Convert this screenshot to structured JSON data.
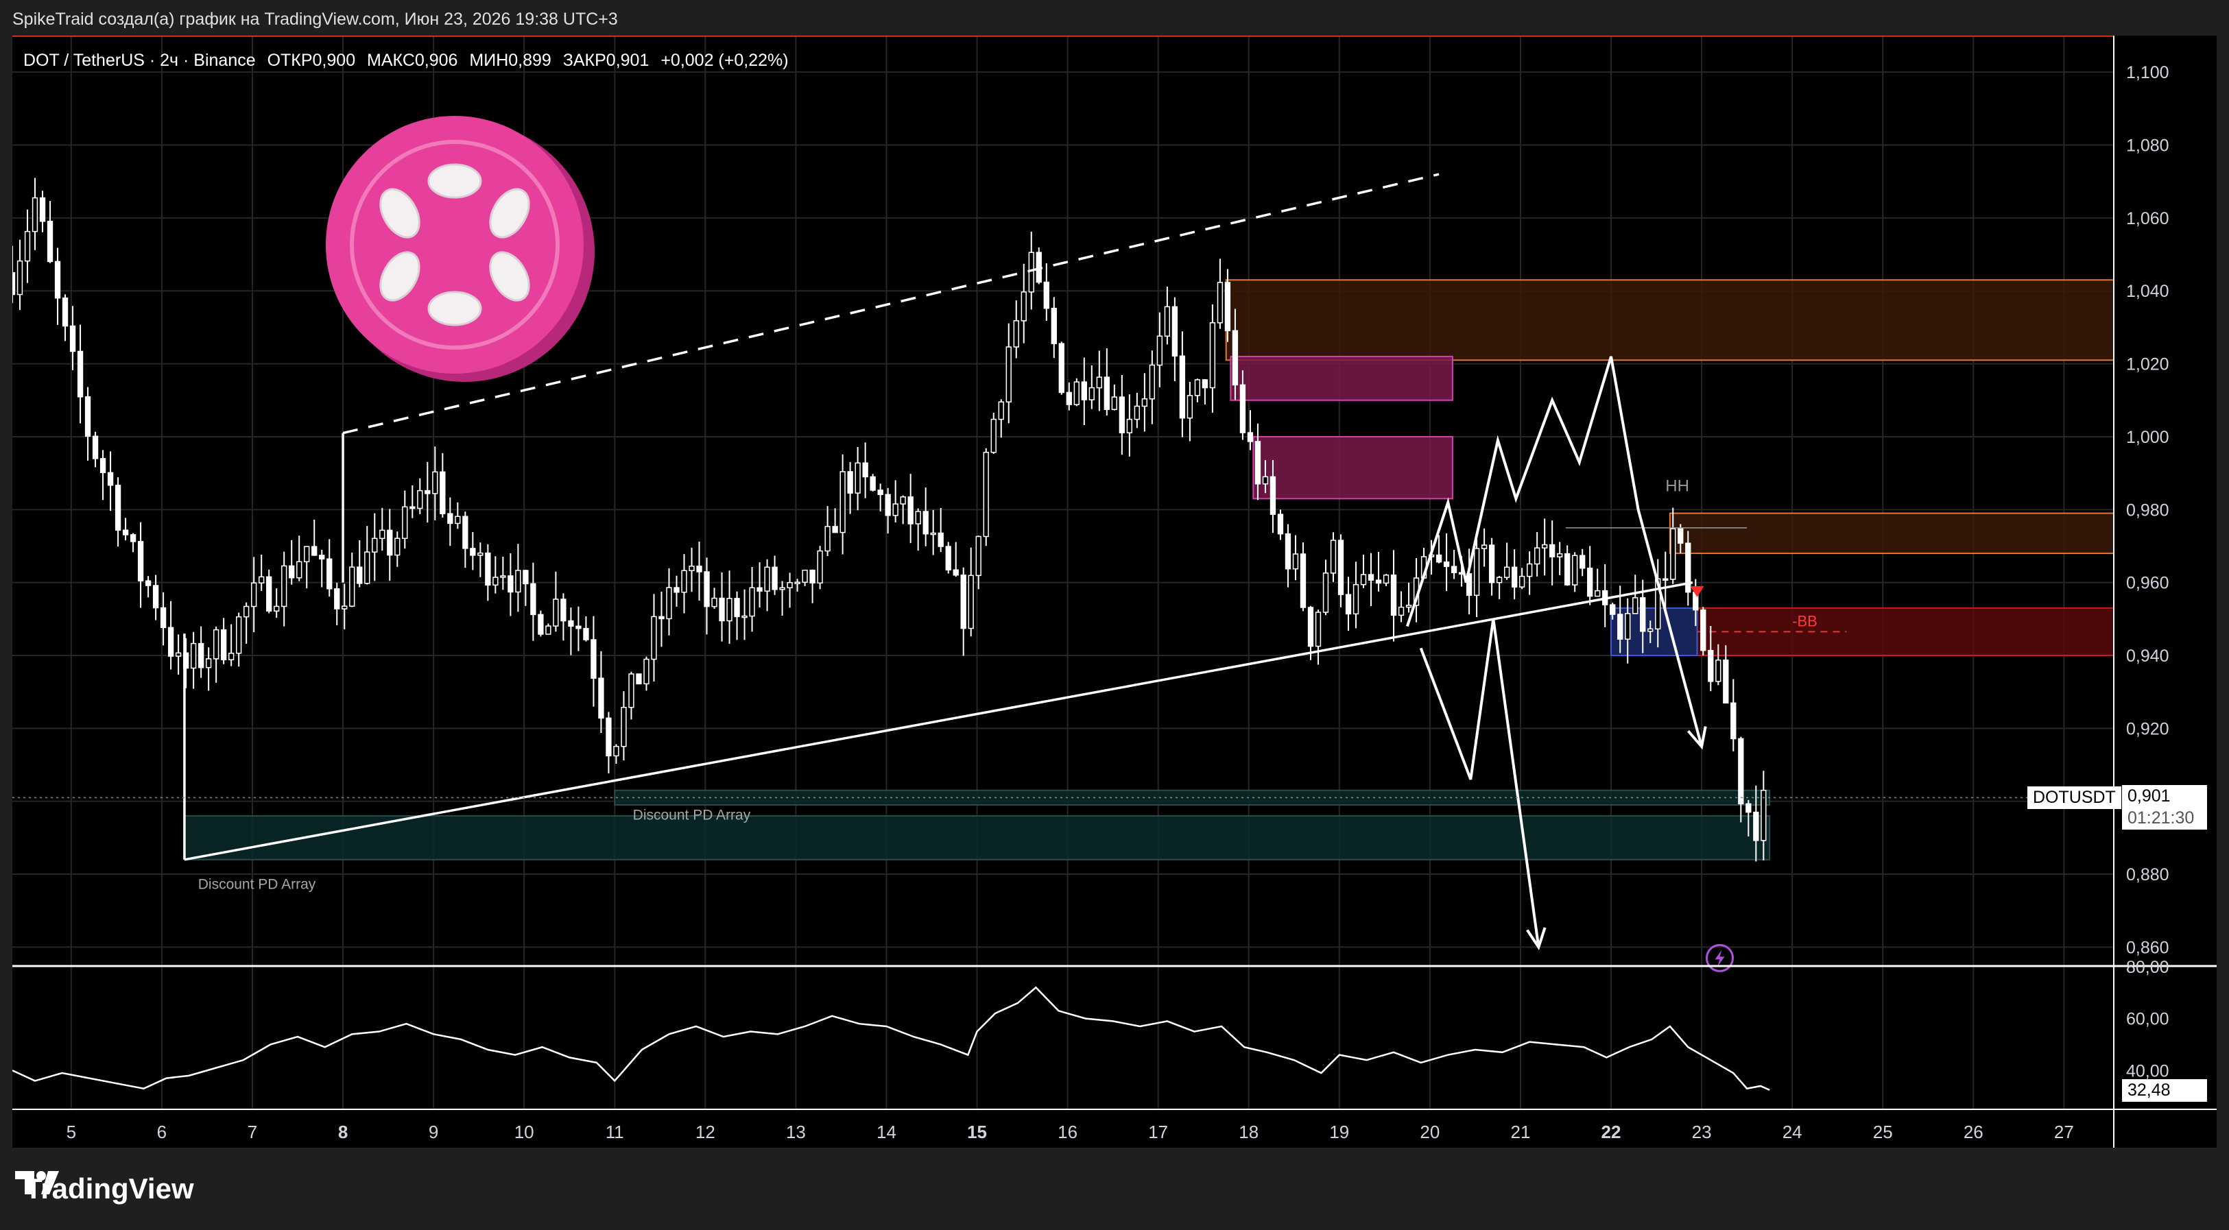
{
  "caption": "SpikeTraid создал(а) график на TradingView.com, Июн 23, 2026 19:38 UTC+3",
  "legend": {
    "symbol": "DOT / TetherUS · 2ч · Binance",
    "open": "ОТКР0,900",
    "high": "МАКС0,906",
    "low": "МИН0,899",
    "close": "ЗАКР0,901",
    "change": "+0,002 (+0,22%)"
  },
  "price_tag": {
    "symbol": "DOTUSDT",
    "price": "0,901",
    "countdown": "01:21:30"
  },
  "rsi_tag": "32,48",
  "labels": {
    "hh": "HH",
    "bb": "-BB",
    "discount1": "Discount PD Array",
    "discount2": "Discount PD Array"
  },
  "brand": "TradingView",
  "colors": {
    "background": "#000000",
    "candle": "#ffffff",
    "resistance_zone": "#3a1a08",
    "orderblock": "#7a1a4a",
    "bearish_zone": "#5a0a0a",
    "discount_zone": "#0a2a2a",
    "breaker": "#1a2a6a",
    "logo": "#e6409c"
  },
  "chart_data": [
    {
      "type": "candlestick",
      "ylim": [
        0.855,
        1.11
      ],
      "xlim": [
        4.35,
        27.55
      ],
      "y_ticks": [
        "1,100",
        "1,080",
        "1,060",
        "1,040",
        "1,020",
        "1,000",
        "0,980",
        "0,960",
        "0,940",
        "0,920",
        "0,900",
        "0,880",
        "0,860"
      ],
      "y_tick_values": [
        1.1,
        1.08,
        1.06,
        1.04,
        1.02,
        1.0,
        0.98,
        0.96,
        0.94,
        0.92,
        0.9,
        0.88,
        0.86
      ],
      "x_ticks": [
        "5",
        "6",
        "7",
        "8",
        "9",
        "10",
        "11",
        "12",
        "13",
        "14",
        "15",
        "16",
        "17",
        "18",
        "19",
        "20",
        "21",
        "22",
        "23",
        "24",
        "25",
        "26",
        "27"
      ],
      "x_tick_values": [
        5,
        6,
        7,
        8,
        9,
        10,
        11,
        12,
        13,
        14,
        15,
        16,
        17,
        18,
        19,
        20,
        21,
        22,
        23,
        24,
        25,
        26,
        27
      ],
      "bold_x_ticks": [
        "8",
        "15",
        "22"
      ],
      "last_price": 0.901,
      "price_path": [
        [
          4.35,
          1.045
        ],
        [
          4.6,
          1.065
        ],
        [
          4.9,
          1.03
        ],
        [
          5.2,
          1.0
        ],
        [
          5.45,
          0.985
        ],
        [
          5.7,
          0.965
        ],
        [
          5.95,
          0.955
        ],
        [
          6.2,
          0.935
        ],
        [
          6.45,
          0.94
        ],
        [
          6.75,
          0.945
        ],
        [
          7.0,
          0.955
        ],
        [
          7.3,
          0.96
        ],
        [
          7.6,
          0.97
        ],
        [
          7.9,
          0.955
        ],
        [
          8.2,
          0.965
        ],
        [
          8.5,
          0.97
        ],
        [
          8.8,
          0.98
        ],
        [
          9.0,
          0.99
        ],
        [
          9.2,
          0.975
        ],
        [
          9.5,
          0.965
        ],
        [
          9.8,
          0.965
        ],
        [
          10.1,
          0.95
        ],
        [
          10.4,
          0.955
        ],
        [
          10.7,
          0.945
        ],
        [
          10.95,
          0.915
        ],
        [
          11.2,
          0.93
        ],
        [
          11.5,
          0.95
        ],
        [
          11.8,
          0.965
        ],
        [
          12.1,
          0.95
        ],
        [
          12.4,
          0.955
        ],
        [
          12.7,
          0.96
        ],
        [
          13.0,
          0.955
        ],
        [
          13.3,
          0.965
        ],
        [
          13.55,
          0.99
        ],
        [
          13.8,
          0.985
        ],
        [
          14.1,
          0.98
        ],
        [
          14.4,
          0.975
        ],
        [
          14.7,
          0.96
        ],
        [
          14.9,
          0.95
        ],
        [
          15.1,
          0.995
        ],
        [
          15.35,
          1.025
        ],
        [
          15.6,
          1.045
        ],
        [
          15.8,
          1.03
        ],
        [
          16.0,
          1.01
        ],
        [
          16.3,
          1.02
        ],
        [
          16.6,
          1.005
        ],
        [
          16.9,
          1.015
        ],
        [
          17.1,
          1.03
        ],
        [
          17.3,
          1.005
        ],
        [
          17.5,
          1.015
        ],
        [
          17.7,
          1.04
        ],
        [
          17.9,
          1.005
        ],
        [
          18.1,
          0.99
        ],
        [
          18.3,
          0.975
        ],
        [
          18.5,
          0.965
        ],
        [
          18.7,
          0.945
        ],
        [
          18.9,
          0.97
        ],
        [
          19.1,
          0.955
        ],
        [
          19.4,
          0.96
        ],
        [
          19.7,
          0.95
        ],
        [
          20.0,
          0.965
        ],
        [
          20.3,
          0.96
        ],
        [
          20.6,
          0.965
        ],
        [
          20.9,
          0.96
        ],
        [
          21.2,
          0.97
        ],
        [
          21.5,
          0.965
        ],
        [
          21.8,
          0.96
        ],
        [
          22.0,
          0.945
        ],
        [
          22.2,
          0.955
        ],
        [
          22.4,
          0.95
        ],
        [
          22.55,
          0.96
        ],
        [
          22.7,
          0.975
        ],
        [
          22.85,
          0.955
        ],
        [
          23.0,
          0.94
        ],
        [
          23.15,
          0.935
        ],
        [
          23.3,
          0.925
        ],
        [
          23.45,
          0.9
        ],
        [
          23.6,
          0.895
        ],
        [
          23.75,
          0.901
        ]
      ],
      "levels": [
        {
          "y": 1.11,
          "x_start": 4.35,
          "x_end": 27.55
        }
      ],
      "zones": [
        {
          "name": "resistance-zone-top",
          "y1": 1.043,
          "y2": 1.021,
          "x1": 17.75,
          "x2": 27.55
        },
        {
          "name": "orderblock-upper",
          "y1": 1.022,
          "y2": 1.01,
          "x1": 17.8,
          "x2": 20.25
        },
        {
          "name": "orderblock-lower",
          "y1": 1.0,
          "y2": 0.983,
          "x1": 18.05,
          "x2": 20.25
        },
        {
          "name": "resistance-zone-mid",
          "y1": 0.979,
          "y2": 0.968,
          "x1": 22.65,
          "x2": 27.55
        },
        {
          "name": "bearish-zone",
          "y1": 0.953,
          "y2": 0.94,
          "x1": 22.95,
          "x2": 27.55
        },
        {
          "name": "breaker-block",
          "y1": 0.953,
          "y2": 0.94,
          "x1": 22.0,
          "x2": 22.95
        },
        {
          "name": "discount-zone-thin",
          "y1": 0.903,
          "y2": 0.899,
          "x1": 11.0,
          "x2": 23.75
        },
        {
          "name": "discount-zone",
          "y1": 0.896,
          "y2": 0.884,
          "x1": 6.25,
          "x2": 23.75
        }
      ],
      "trendlines": [
        {
          "name": "rising-support",
          "points": [
            [
              6.25,
              0.884
            ],
            [
              22.9,
              0.96
            ]
          ],
          "dashed": false
        },
        {
          "name": "rising-resistance",
          "points": [
            [
              8.0,
              1.001
            ],
            [
              20.1,
              1.072
            ]
          ],
          "dashed": true
        },
        {
          "name": "discount-left-edge",
          "points": [
            [
              6.25,
              0.946
            ],
            [
              6.25,
              0.884
            ]
          ],
          "dashed": false
        },
        {
          "name": "resistance-left-edge",
          "points": [
            [
              8.0,
              1.001
            ],
            [
              8.0,
              0.96
            ]
          ],
          "dashed": false
        },
        {
          "name": "hh-line",
          "points": [
            [
              21.5,
              0.975
            ],
            [
              23.5,
              0.975
            ]
          ],
          "dashed": false
        }
      ],
      "projections": [
        {
          "name": "zigzag-projection",
          "points": [
            [
              19.75,
              0.948
            ],
            [
              20.2,
              0.982
            ],
            [
              20.4,
              0.96
            ],
            [
              20.75,
              0.999
            ],
            [
              20.95,
              0.983
            ],
            [
              21.35,
              1.01
            ],
            [
              21.65,
              0.993
            ],
            [
              22.0,
              1.022
            ],
            [
              22.3,
              0.98
            ],
            [
              23.0,
              0.915
            ]
          ]
        },
        {
          "name": "zigzag-down",
          "points": [
            [
              19.9,
              0.942
            ],
            [
              20.45,
              0.906
            ],
            [
              20.7,
              0.95
            ],
            [
              21.2,
              0.86
            ]
          ]
        }
      ]
    },
    {
      "type": "line",
      "name": "",
      "ylim": [
        25,
        80
      ],
      "y_ticks": [
        "80,00",
        "60,00",
        "40,00"
      ],
      "y_tick_values": [
        80,
        60,
        40
      ],
      "last_value": 32.48,
      "points": [
        [
          4.35,
          40
        ],
        [
          4.6,
          36
        ],
        [
          4.9,
          39
        ],
        [
          5.2,
          37
        ],
        [
          5.5,
          35
        ],
        [
          5.8,
          33
        ],
        [
          6.05,
          37
        ],
        [
          6.3,
          38
        ],
        [
          6.6,
          41
        ],
        [
          6.9,
          44
        ],
        [
          7.2,
          50
        ],
        [
          7.5,
          53
        ],
        [
          7.8,
          49
        ],
        [
          8.1,
          54
        ],
        [
          8.4,
          55
        ],
        [
          8.7,
          58
        ],
        [
          9.0,
          54
        ],
        [
          9.3,
          52
        ],
        [
          9.6,
          48
        ],
        [
          9.9,
          46
        ],
        [
          10.2,
          49
        ],
        [
          10.5,
          45
        ],
        [
          10.8,
          43
        ],
        [
          11.0,
          36
        ],
        [
          11.3,
          48
        ],
        [
          11.6,
          54
        ],
        [
          11.9,
          57
        ],
        [
          12.2,
          53
        ],
        [
          12.5,
          55
        ],
        [
          12.8,
          54
        ],
        [
          13.1,
          57
        ],
        [
          13.4,
          61
        ],
        [
          13.7,
          58
        ],
        [
          14.0,
          57
        ],
        [
          14.3,
          53
        ],
        [
          14.6,
          50
        ],
        [
          14.9,
          46
        ],
        [
          15.0,
          55
        ],
        [
          15.2,
          62
        ],
        [
          15.45,
          66
        ],
        [
          15.65,
          72
        ],
        [
          15.9,
          63
        ],
        [
          16.2,
          60
        ],
        [
          16.5,
          59
        ],
        [
          16.8,
          57
        ],
        [
          17.1,
          59
        ],
        [
          17.4,
          55
        ],
        [
          17.7,
          57
        ],
        [
          17.95,
          49
        ],
        [
          18.2,
          47
        ],
        [
          18.5,
          44
        ],
        [
          18.8,
          39
        ],
        [
          19.0,
          46
        ],
        [
          19.3,
          44
        ],
        [
          19.6,
          47
        ],
        [
          19.9,
          43
        ],
        [
          20.2,
          46
        ],
        [
          20.5,
          48
        ],
        [
          20.8,
          47
        ],
        [
          21.1,
          51
        ],
        [
          21.4,
          50
        ],
        [
          21.7,
          49
        ],
        [
          21.95,
          45
        ],
        [
          22.2,
          49
        ],
        [
          22.45,
          52
        ],
        [
          22.65,
          57
        ],
        [
          22.85,
          49
        ],
        [
          23.0,
          46
        ],
        [
          23.2,
          42
        ],
        [
          23.35,
          39
        ],
        [
          23.5,
          33
        ],
        [
          23.65,
          34
        ],
        [
          23.75,
          32.48
        ]
      ]
    }
  ]
}
